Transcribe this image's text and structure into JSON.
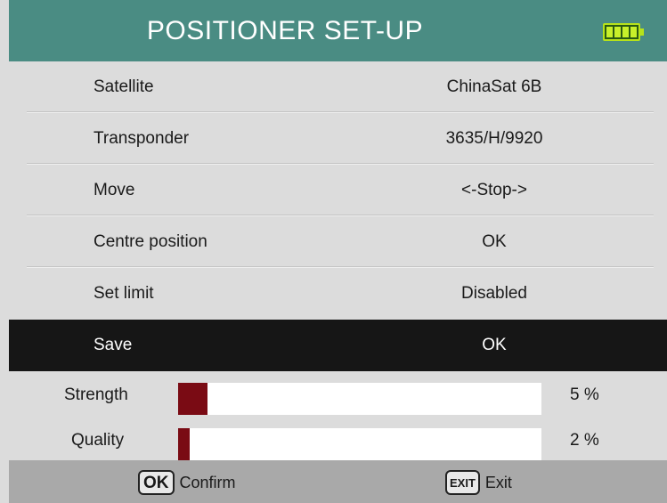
{
  "header": {
    "title": "POSITIONER SET-UP",
    "battery_icon": "battery-full-icon"
  },
  "menu": [
    {
      "label": "Satellite",
      "value": "ChinaSat 6B",
      "selected": false
    },
    {
      "label": "Transponder",
      "value": "3635/H/9920",
      "selected": false
    },
    {
      "label": "Move",
      "value": "<-Stop->",
      "selected": false
    },
    {
      "label": "Centre position",
      "value": "OK",
      "selected": false
    },
    {
      "label": "Set limit",
      "value": "Disabled",
      "selected": false
    },
    {
      "label": "Save",
      "value": "OK",
      "selected": true
    }
  ],
  "signal": {
    "strength": {
      "label": "Strength",
      "percent_text": "5 %",
      "level": 5
    },
    "quality": {
      "label": "Quality",
      "percent_text": "2 %",
      "level": 2
    }
  },
  "footer": {
    "ok_key": "OK",
    "ok_label": "Confirm",
    "exit_key": "EXIT",
    "exit_label": "Exit"
  },
  "colors": {
    "header_bg": "#4a8c83",
    "selected_bg": "#161616",
    "bar_fill": "#7a0b14",
    "battery": "#c8f02a"
  }
}
